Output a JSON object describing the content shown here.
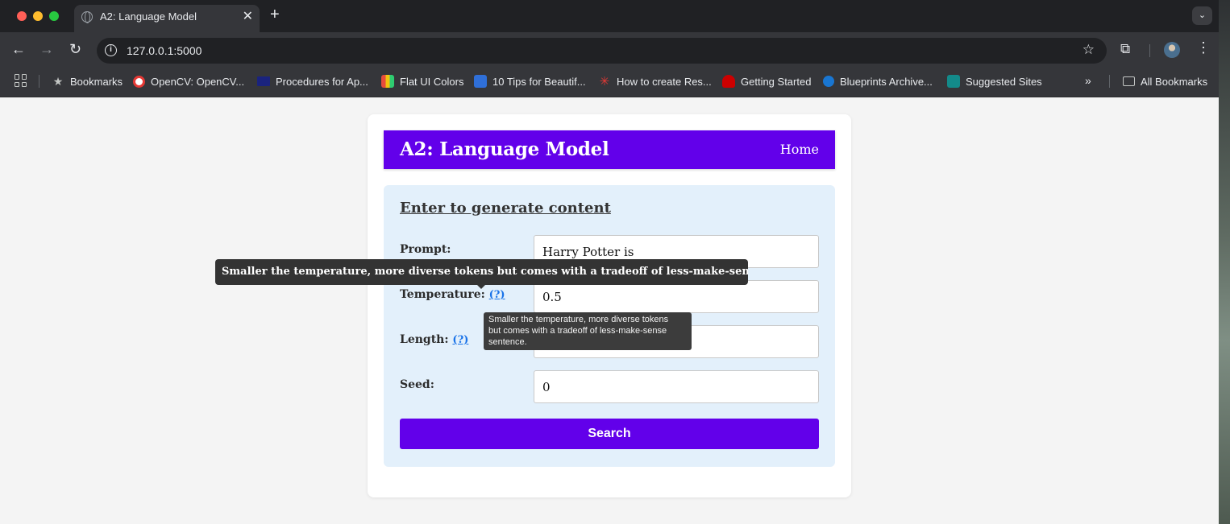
{
  "browser": {
    "tab_title": "A2: Language Model",
    "url": "127.0.0.1:5000",
    "bookmarks": [
      {
        "label": "Bookmarks",
        "icon": "star-icon"
      },
      {
        "label": "OpenCV: OpenCV...",
        "icon": "opencv-favicon"
      },
      {
        "label": "Procedures for Ap...",
        "icon": "adb-favicon"
      },
      {
        "label": "Flat UI Colors",
        "icon": "flat-ui-colors-favicon"
      },
      {
        "label": "10 Tips for Beautif...",
        "icon": "tips-favicon"
      },
      {
        "label": "How to create Res...",
        "icon": "asterisk-favicon"
      },
      {
        "label": "Getting Started",
        "icon": "redhat-favicon"
      },
      {
        "label": "Blueprints Archive...",
        "icon": "blueprints-favicon"
      },
      {
        "label": "Suggested Sites",
        "icon": "bing-favicon"
      }
    ],
    "more_bookmarks": "»",
    "all_bookmarks": "All Bookmarks"
  },
  "app": {
    "title": "A2: Language Model",
    "nav_home": "Home",
    "form_heading": "Enter to generate content",
    "fields": {
      "prompt": {
        "label": "Prompt:",
        "value": "Harry Potter is"
      },
      "temperature": {
        "label": "Temperature:",
        "help": "(?)",
        "value": "0.5"
      },
      "length": {
        "label": "Length:",
        "help": "(?)",
        "value": ""
      },
      "seed": {
        "label": "Seed:",
        "value": "0"
      }
    },
    "search_button": "Search"
  },
  "tooltips": {
    "large": "Smaller the temperature, more diverse tokens but comes with a tradeoff of less-make-sense sentence.",
    "small_lines": [
      "Smaller the temperature, more diverse tokens",
      "but comes with a tradeoff of less-make-sense",
      "sentence."
    ]
  },
  "colors": {
    "accent": "#6200ea",
    "panel": "#e3f0fb",
    "page_bg": "#f4f4f4",
    "help_link": "#1a73e8"
  }
}
